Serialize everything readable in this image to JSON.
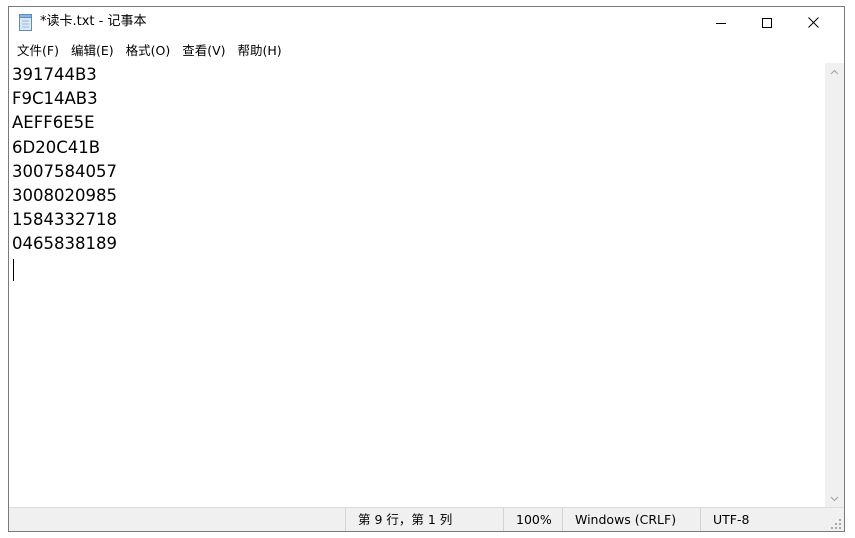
{
  "window": {
    "title": "*读卡.txt - 记事本",
    "icons": {
      "app": "notepad-icon",
      "minimize": "minimize-icon",
      "maximize": "maximize-icon",
      "close": "close-icon"
    }
  },
  "menu": [
    "文件(F)",
    "编辑(E)",
    "格式(O)",
    "查看(V)",
    "帮助(H)"
  ],
  "editor": {
    "lines": [
      "391744B3",
      "F9C14AB3",
      "AEFF6E5E",
      "6D20C41B",
      "3007584057",
      "3008020985",
      "1584332718",
      "0465838189",
      ""
    ]
  },
  "status": {
    "position": "第 9 行，第 1 列",
    "zoom": "100%",
    "line_ending": "Windows (CRLF)",
    "encoding": "UTF-8"
  }
}
